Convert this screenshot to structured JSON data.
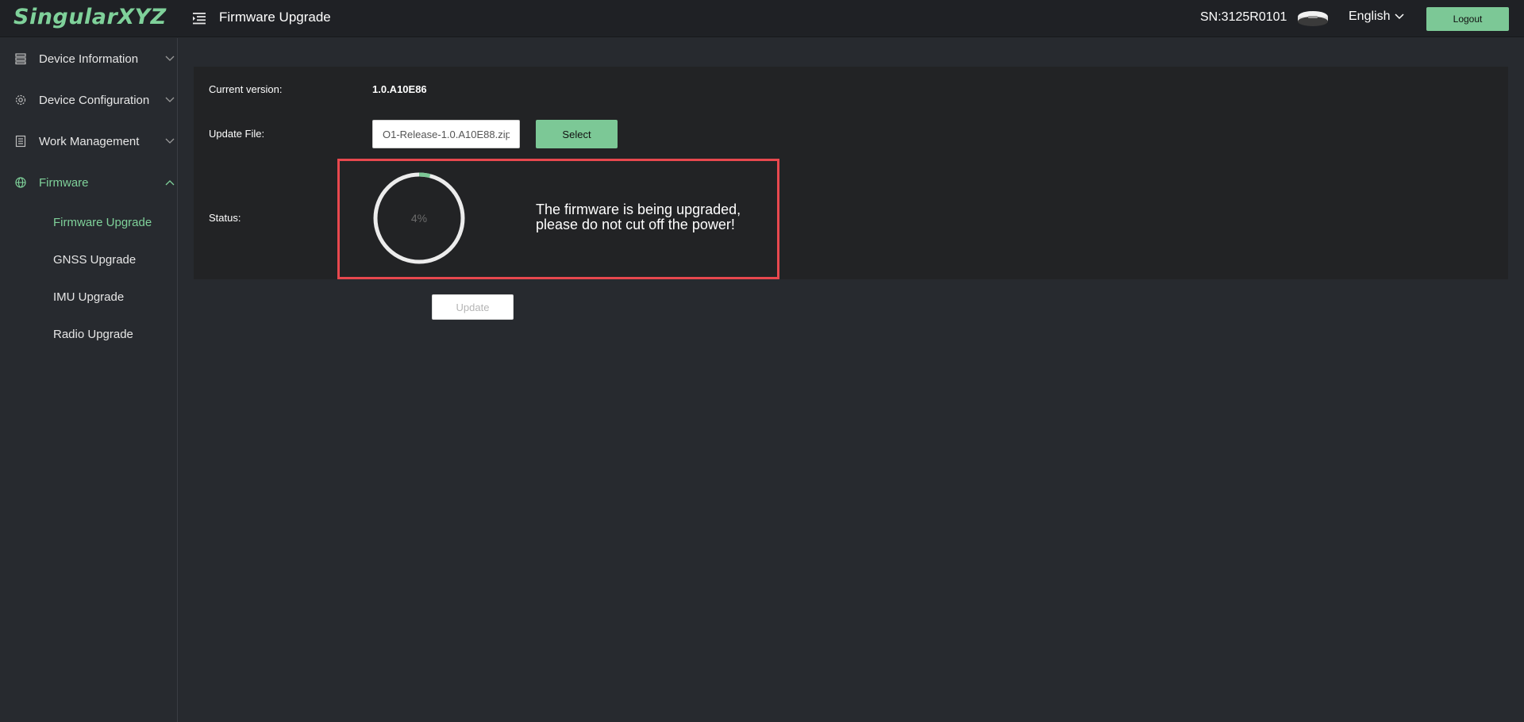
{
  "header": {
    "logo": "SingularXYZ",
    "page_title": "Firmware Upgrade",
    "serial": "SN:3125R0101",
    "language": "English",
    "logout_label": "Logout"
  },
  "sidebar": {
    "items": [
      {
        "label": "Device Information",
        "icon": "list-icon"
      },
      {
        "label": "Device Configuration",
        "icon": "gear-icon"
      },
      {
        "label": "Work Management",
        "icon": "server-icon"
      },
      {
        "label": "Firmware",
        "icon": "globe-icon"
      }
    ],
    "firmware_sub": [
      {
        "label": "Firmware Upgrade"
      },
      {
        "label": "GNSS Upgrade"
      },
      {
        "label": "IMU Upgrade"
      },
      {
        "label": "Radio Upgrade"
      }
    ]
  },
  "main": {
    "current_version_label": "Current version:",
    "current_version_value": "1.0.A10E86",
    "update_file_label": "Update File:",
    "update_file_value": "O1-Release-1.0.A10E88.zip",
    "select_label": "Select",
    "status_label": "Status:",
    "progress_percent": 4,
    "progress_text": "4%",
    "status_message": "The firmware is being upgraded, please do not cut off the power!",
    "update_label": "Update"
  },
  "colors": {
    "accent": "#7cc896",
    "header_bg": "#1f2125",
    "page_bg": "#272a2f",
    "panel_bg": "#222325",
    "highlight_border": "#e8484e"
  }
}
